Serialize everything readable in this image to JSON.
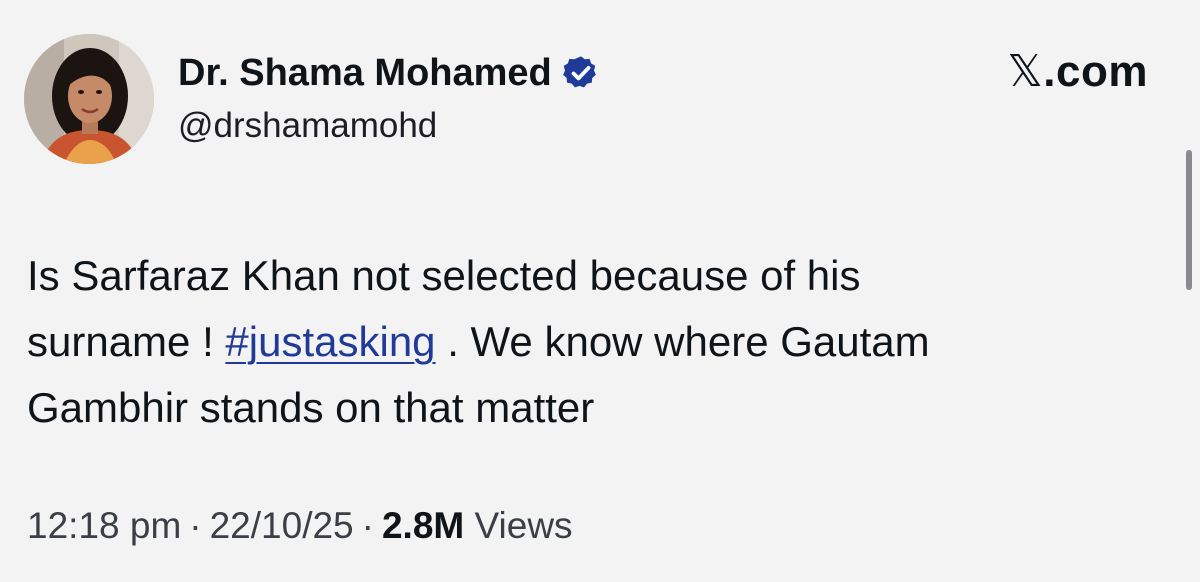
{
  "author": {
    "display_name": "Dr. Shama Mohamed",
    "handle": "@drshamamohd",
    "verified_icon": "verified-badge-icon",
    "avatar_icon": "profile-photo"
  },
  "brand": {
    "logo_glyph": "𝕏",
    "logo_suffix": ".com"
  },
  "tweet": {
    "line1": "Is Sarfaraz Khan not selected because of his",
    "line2_before": "surname ! ",
    "hashtag": "#justasking",
    "line2_after": " . We know where Gautam",
    "line3": "Gambhir stands on that matter"
  },
  "meta": {
    "time": "12:18 pm",
    "separator": "·",
    "date": "22/10/25",
    "views_count": "2.8M",
    "views_label": " Views"
  },
  "colors": {
    "background": "#f3f3f4",
    "hashtag": "#1f3a98",
    "verified": "#1f3a98"
  }
}
